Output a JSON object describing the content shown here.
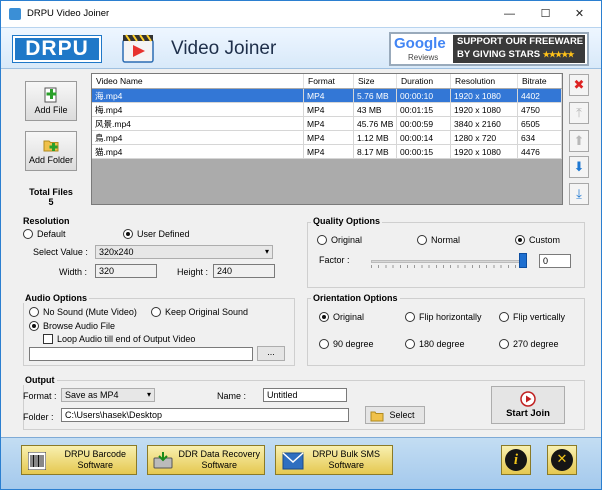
{
  "window": {
    "title": "DRPU Video Joiner",
    "controls": [
      "—",
      "☐",
      "✕"
    ]
  },
  "header": {
    "logo": "DRPU",
    "app_name": "Video Joiner",
    "google_word": "Google",
    "google_sub": "Reviews",
    "support_line1": "SUPPORT OUR FREEWARE",
    "support_line2": "BY GIVING STARS",
    "stars": "★★★★★"
  },
  "left_panel": {
    "add_file": "Add File",
    "add_folder": "Add Folder",
    "total_label": "Total Files",
    "total_count": "5"
  },
  "file_table": {
    "columns": [
      "Video Name",
      "Format",
      "Size",
      "Duration",
      "Resolution",
      "Bitrate"
    ],
    "rows": [
      [
        "海.mp4",
        "MP4",
        "5.76 MB",
        "00:00:10",
        "1920 x 1080",
        "4402"
      ],
      [
        "梅.mp4",
        "MP4",
        "43 MB",
        "00:01:15",
        "1920 x 1080",
        "4750"
      ],
      [
        "风景.mp4",
        "MP4",
        "45.76 MB",
        "00:00:59",
        "3840 x 2160",
        "6505"
      ],
      [
        "鳥.mp4",
        "MP4",
        "1.12 MB",
        "00:00:14",
        "1280 x 720",
        "634"
      ],
      [
        "猫.mp4",
        "MP4",
        "8.17 MB",
        "00:00:15",
        "1920 x 1080",
        "4476"
      ]
    ],
    "selected_row": 0
  },
  "resolution": {
    "title": "Resolution",
    "default_label": "Default",
    "user_defined_label": "User Defined",
    "selected": "User Defined",
    "select_value_label": "Select Value :",
    "select_value": "320x240",
    "width_label": "Width :",
    "width": "320",
    "height_label": "Height :",
    "height": "240"
  },
  "quality": {
    "title": "Quality Options",
    "options": [
      "Original",
      "Normal",
      "Custom"
    ],
    "selected": "Custom",
    "factor_label": "Factor :",
    "factor_value": "0",
    "slider_fraction": 1.0
  },
  "audio": {
    "title": "Audio Options",
    "no_sound": "No Sound (Mute Video)",
    "keep_original": "Keep Original Sound",
    "browse": "Browse Audio File",
    "selected": "Browse Audio File",
    "loop_label": "Loop Audio till end of Output Video",
    "loop_checked": false,
    "audio_path": "",
    "browse_btn": "..."
  },
  "orientation": {
    "title": "Orientation Options",
    "options": [
      "Original",
      "Flip horizontally",
      "Flip vertically",
      "90 degree",
      "180 degree",
      "270 degree"
    ],
    "selected": "Original"
  },
  "output": {
    "title": "Output",
    "format_label": "Format :",
    "format_value": "Save as MP4",
    "name_label": "Name :",
    "name_value": "Untitled",
    "folder_label": "Folder :",
    "folder_value": "C:\\Users\\hasek\\Desktop",
    "select_btn": "Select",
    "start_btn": "Start Join"
  },
  "bottom": {
    "barcode_line1": "DRPU Barcode",
    "barcode_line2": "Software",
    "ddr_line1": "DDR Data Recovery",
    "ddr_line2": "Software",
    "sms_line1": "DRPU Bulk SMS",
    "sms_line2": "Software",
    "info_glyph": "i",
    "close_glyph": "✕"
  },
  "colors": {
    "accent": "#3377d6",
    "brand": "#1f78c8",
    "promo": "#e5c850"
  }
}
